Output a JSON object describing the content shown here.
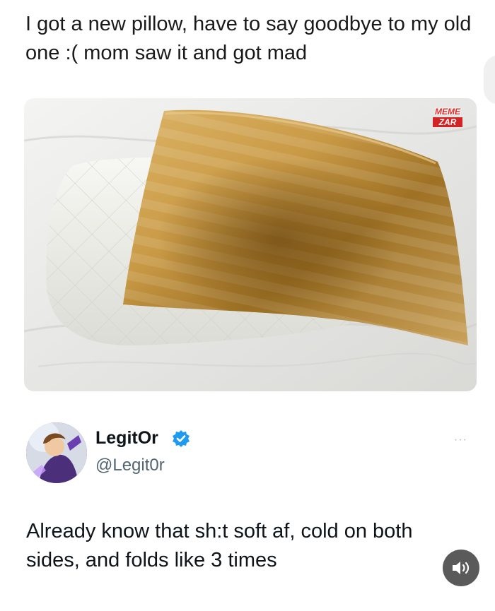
{
  "post": {
    "caption": "I got a new pillow, have to say goodbye to my old one :( mom saw it and got mad"
  },
  "image": {
    "watermark_line1": "MEME",
    "watermark_line2": "ZAR"
  },
  "tweet": {
    "display_name": "LegitOr",
    "handle": "@Legit0r",
    "text": "Already know that sh:t soft af, cold on both sides, and folds like 3 times",
    "more_label": "···"
  },
  "icons": {
    "verified": "verified-badge-icon",
    "sound": "speaker-icon"
  },
  "colors": {
    "verified_blue": "#1d9bf0",
    "sound_button": "#5a5a5a"
  }
}
